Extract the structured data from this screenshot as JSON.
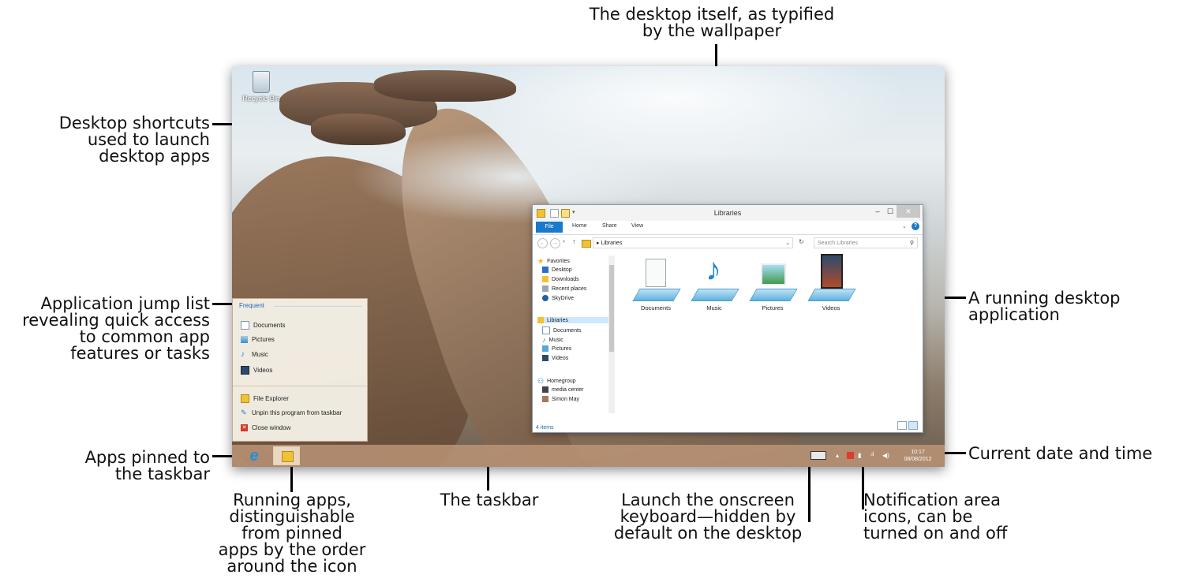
{
  "callouts": {
    "wallpaper": [
      "The desktop itself, as typified",
      "by the wallpaper"
    ],
    "shortcuts": [
      "Desktop shortcuts",
      "used to launch",
      "desktop apps"
    ],
    "jumplist": [
      "Application jump list",
      "revealing quick access",
      "to common app",
      "features or tasks"
    ],
    "running_app": [
      "A running desktop",
      "application"
    ],
    "pinned": [
      "Apps pinned to",
      "the taskbar"
    ],
    "running_apps": [
      "Running apps,",
      "distinguishable",
      "from pinned",
      "apps by the order",
      "around the icon"
    ],
    "taskbar": [
      "The taskbar"
    ],
    "keyboard": [
      "Launch the onscreen",
      "keyboard—hidden by",
      "default on the desktop"
    ],
    "notification": [
      "Notification area",
      "icons, can be",
      "turned on and off"
    ],
    "datetime": [
      "Current date and time"
    ]
  },
  "desktop": {
    "recycle_bin_label": "Recycle Bin"
  },
  "jumplist": {
    "header": "Frequent",
    "frequent": [
      {
        "label": "Documents",
        "icon": "documents-icon"
      },
      {
        "label": "Pictures",
        "icon": "pictures-icon"
      },
      {
        "label": "Music",
        "icon": "music-icon"
      },
      {
        "label": "Videos",
        "icon": "videos-icon"
      }
    ],
    "tasks": [
      {
        "label": "File Explorer",
        "icon": "folder-icon"
      },
      {
        "label": "Unpin this program from taskbar",
        "icon": "unpin-icon"
      },
      {
        "label": "Close window",
        "icon": "close-window-icon"
      }
    ]
  },
  "explorer": {
    "title": "Libraries",
    "ribbon_tabs": [
      "File",
      "Home",
      "Share",
      "View"
    ],
    "address": "Libraries",
    "search_placeholder": "Search Libraries",
    "nav": {
      "favorites": "Favorites",
      "favorites_items": [
        "Desktop",
        "Downloads",
        "Recent places",
        "SkyDrive"
      ],
      "libraries": "Libraries",
      "libraries_items": [
        "Documents",
        "Music",
        "Pictures",
        "Videos"
      ],
      "homegroup": "Homegroup",
      "homegroup_items": [
        "media center",
        "Simon May"
      ]
    },
    "libraries": [
      "Documents",
      "Music",
      "Pictures",
      "Videos"
    ],
    "status": "4 items"
  },
  "taskbar": {
    "time": "10:17",
    "date": "08/08/2012"
  },
  "colors": {
    "accent": "#1979ca",
    "ie_blue": "#1e90e0"
  }
}
